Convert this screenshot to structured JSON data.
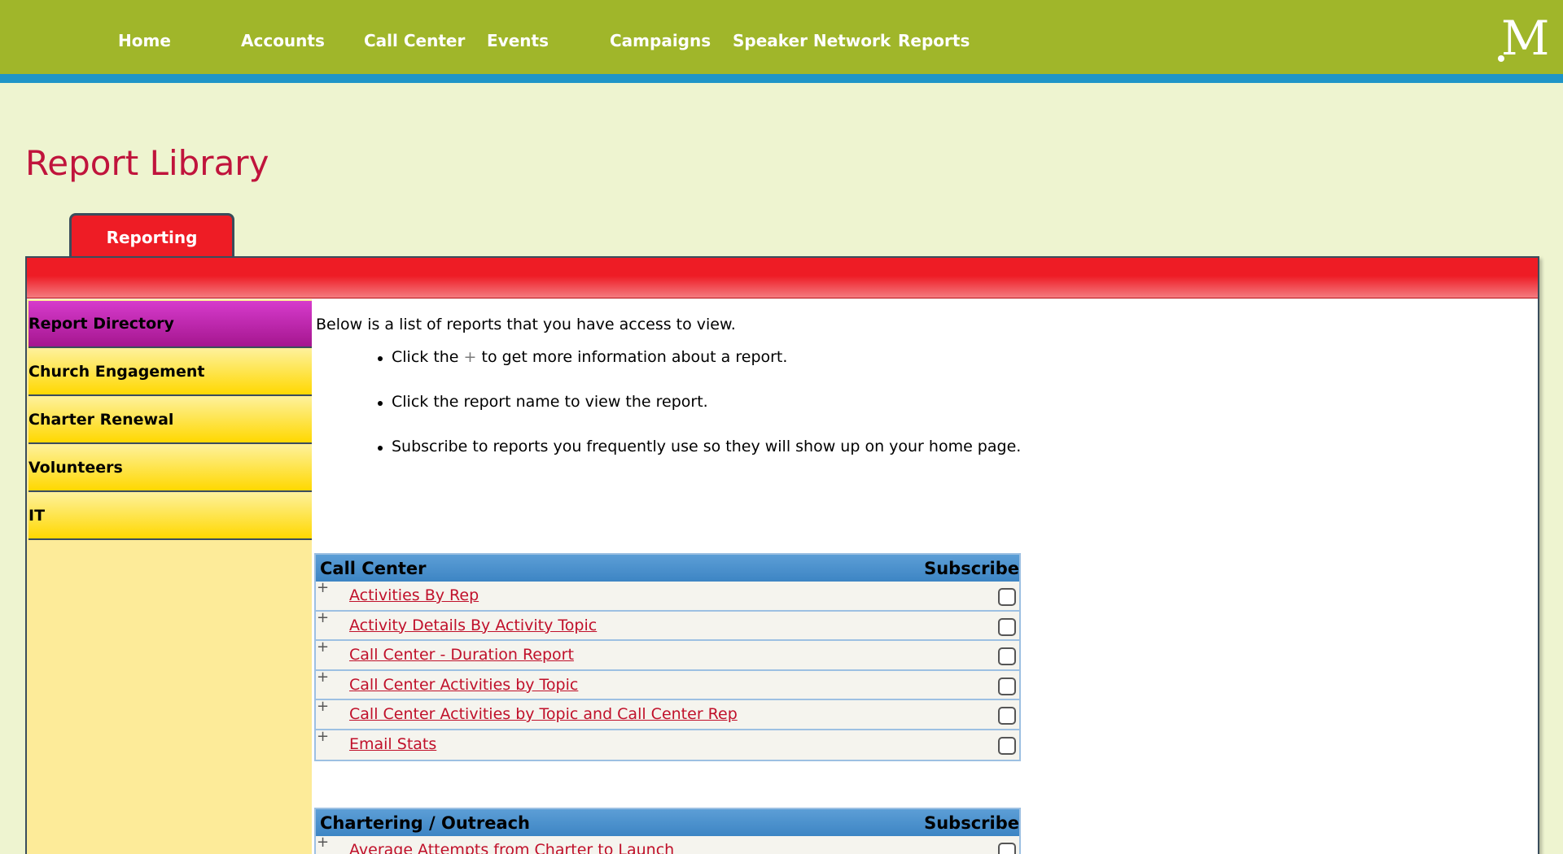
{
  "nav": {
    "items": [
      "Home",
      "Accounts",
      "Call Center",
      "Events",
      "Campaigns",
      "Speaker Network",
      "Reports"
    ],
    "logo_letter": "M"
  },
  "page": {
    "title": "Report Library",
    "tab_label": "Reporting"
  },
  "sidebar": {
    "items": [
      "Report Directory",
      "Church Engagement",
      "Charter Renewal",
      "Volunteers",
      "IT"
    ]
  },
  "content": {
    "intro": "Below is a list of reports that you have access to view.",
    "bullet1_before": "Click the ",
    "bullet1_plus": "+",
    "bullet1_after": " to get more information about a report.",
    "bullet2": "Click the report name to view the report.",
    "bullet3": "Subscribe to reports you frequently use so they will show up on your home page."
  },
  "tables": [
    {
      "title": "Call Center",
      "subscribe_label": "Subscribe",
      "rows": [
        {
          "plus": "+",
          "name": "Activities By Rep",
          "subscribed": false
        },
        {
          "plus": "+",
          "name": "Activity Details By Activity Topic",
          "subscribed": false
        },
        {
          "plus": "+",
          "name": "Call Center - Duration Report",
          "subscribed": false
        },
        {
          "plus": "+",
          "name": "Call Center Activities by Topic",
          "subscribed": false
        },
        {
          "plus": "+",
          "name": "Call Center Activities by Topic and Call Center Rep",
          "subscribed": false
        },
        {
          "plus": "+",
          "name": "Email Stats",
          "subscribed": false
        }
      ]
    },
    {
      "title": "Chartering / Outreach",
      "subscribe_label": "Subscribe",
      "rows": [
        {
          "plus": "+",
          "name": "Average Attempts from Charter to Launch",
          "subscribed": false
        }
      ]
    }
  ],
  "colors": {
    "nav_bg": "#a0b62a",
    "nav_stripe": "#1f95c7",
    "title": "#c0143c",
    "tab_red": "#ee1c25",
    "sidebar_active": "#a5168f",
    "sidebar_item": "#ffd800",
    "link": "#c0102a",
    "table_header": "#3d85c4"
  }
}
